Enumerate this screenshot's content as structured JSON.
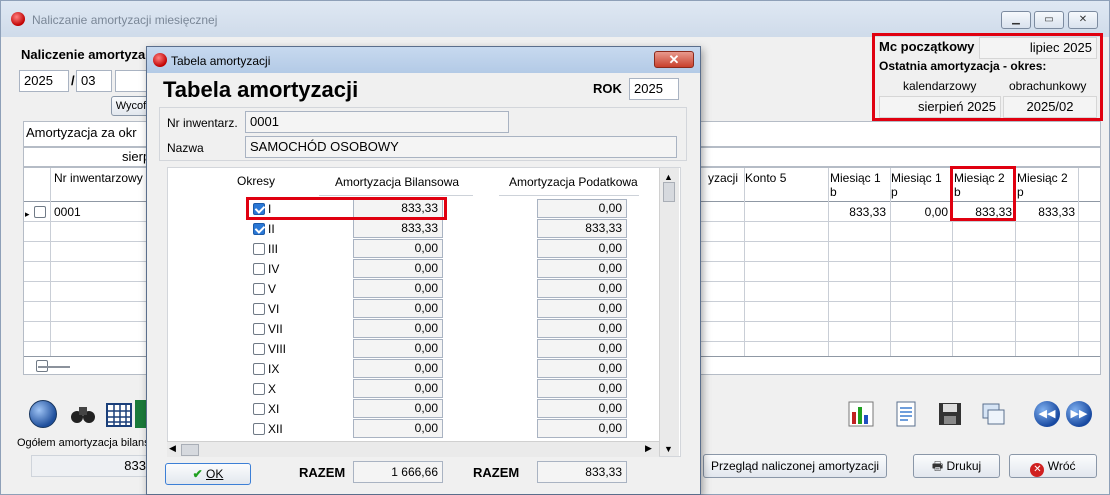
{
  "main": {
    "title": "Naliczanie amortyzacji miesięcznej",
    "heading": "Naliczenie amortyza",
    "year": "2025",
    "separator": "/",
    "month": "03",
    "wycofaj_label": "Wycof",
    "mc_poczatkowy_label": "Mc początkowy",
    "mc_poczatkowy_value": "lipiec 2025",
    "ostatnia_label": "Ostatnia amortyzacja - okres:",
    "kalendarzowy_label": "kalendarzowy",
    "obrachunkowy_label": "obrachunkowy",
    "kalendarzowy_value": "sierpień 2025",
    "obrachunkowy_value": "2025/02",
    "amortyzacja_za_label": "Amortyzacja za okr",
    "sierpien_label": "sierp",
    "grid": {
      "headers": [
        "Nr inwentarzowy",
        "yzacji",
        "Konto 5",
        "Miesiąc 1\nb",
        "Miesiąc 1\np",
        "Miesiąc 2\nb",
        "Miesiąc 2\np"
      ],
      "row": {
        "nr": "0001",
        "m1b": "833,33",
        "m1p": "0,00",
        "m2b": "833,33",
        "m2p": "833,33"
      }
    },
    "ogolem_label": "Ogółem amortyzacja bilans",
    "ogolem_value": "833",
    "przeglad_label": "Przegląd naliczonej amortyzacji",
    "drukuj_label": "Drukuj",
    "wroc_label": "Wróć"
  },
  "dialog": {
    "title": "Tabela amortyzacji",
    "heading": "Tabela amortyzacji",
    "rok_label": "ROK",
    "rok_value": "2025",
    "nr_label": "Nr inwentarz.",
    "nr_value": "0001",
    "nazwa_label": "Nazwa",
    "nazwa_value": "SAMOCHÓD OSOBOWY",
    "col_okresy": "Okresy",
    "col_bilansowa": "Amortyzacja Bilansowa",
    "col_podatkowa": "Amortyzacja Podatkowa",
    "rows": [
      {
        "label": "I",
        "checked": true,
        "bil": "833,33",
        "pod": "0,00"
      },
      {
        "label": "II",
        "checked": true,
        "bil": "833,33",
        "pod": "833,33"
      },
      {
        "label": "III",
        "checked": false,
        "bil": "0,00",
        "pod": "0,00"
      },
      {
        "label": "IV",
        "checked": false,
        "bil": "0,00",
        "pod": "0,00"
      },
      {
        "label": "V",
        "checked": false,
        "bil": "0,00",
        "pod": "0,00"
      },
      {
        "label": "VI",
        "checked": false,
        "bil": "0,00",
        "pod": "0,00"
      },
      {
        "label": "VII",
        "checked": false,
        "bil": "0,00",
        "pod": "0,00"
      },
      {
        "label": "VIII",
        "checked": false,
        "bil": "0,00",
        "pod": "0,00"
      },
      {
        "label": "IX",
        "checked": false,
        "bil": "0,00",
        "pod": "0,00"
      },
      {
        "label": "X",
        "checked": false,
        "bil": "0,00",
        "pod": "0,00"
      },
      {
        "label": "XI",
        "checked": false,
        "bil": "0,00",
        "pod": "0,00"
      },
      {
        "label": "XII",
        "checked": false,
        "bil": "0,00",
        "pod": "0,00"
      }
    ],
    "razem_label": "RAZEM",
    "razem_bil": "1 666,66",
    "razem_pod": "833,33",
    "ok_label": "OK"
  }
}
